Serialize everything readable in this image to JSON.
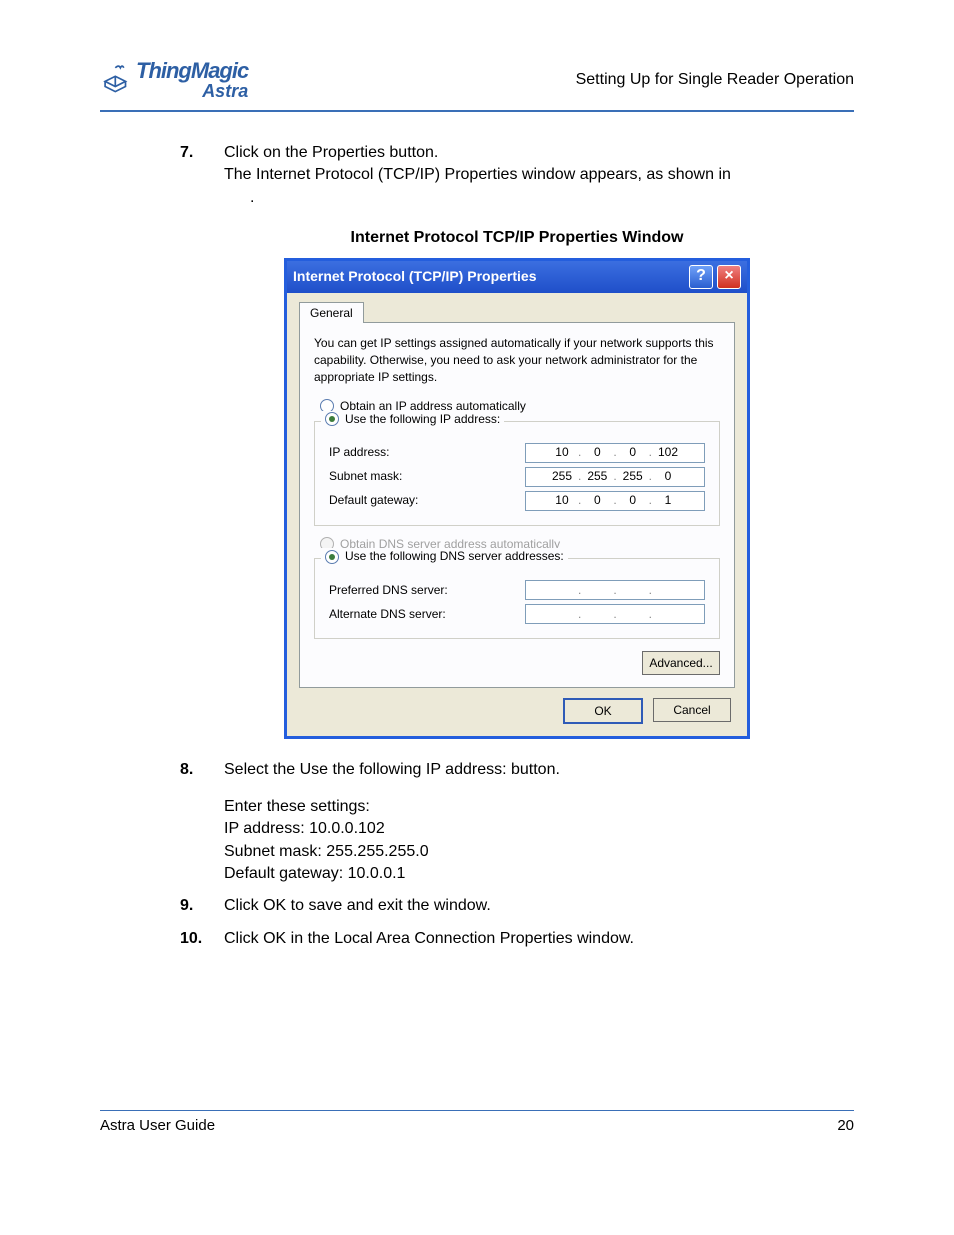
{
  "header": {
    "logo_main": "ThingMagic",
    "logo_sub": "Astra",
    "section": "Setting Up for Single Reader Operation"
  },
  "steps": {
    "s7_num": "7.",
    "s7_l1": "Click on the Properties button.",
    "s7_l2": "The Internet Protocol (TCP/IP) Properties window appears, as shown in",
    "s7_l3": ".",
    "figure_title": "Internet Protocol TCP/IP Properties Window",
    "s8_num": "8.",
    "s8_l1": "Select the Use the following IP address: button.",
    "s8_l2": "Enter these settings:",
    "s8_l3": "IP address: 10.0.0.102",
    "s8_l4": "Subnet mask: 255.255.255.0",
    "s8_l5": "Default gateway: 10.0.0.1",
    "s9_num": "9.",
    "s9_l1": "Click OK to save and exit the window.",
    "s10_num": "10.",
    "s10_l1": "Click OK in the Local Area Connection Properties window."
  },
  "dialog": {
    "title": "Internet Protocol (TCP/IP) Properties",
    "help": "?",
    "close": "×",
    "tab": "General",
    "desc": "You can get IP settings assigned automatically if your network supports this capability. Otherwise, you need to ask your network administrator for the appropriate IP settings.",
    "r_obtain_ip": "Obtain an IP address automatically",
    "r_use_ip": "Use the following IP address:",
    "lbl_ip": "IP address:",
    "lbl_subnet": "Subnet mask:",
    "lbl_gw": "Default gateway:",
    "ip": {
      "a": "10",
      "b": "0",
      "c": "0",
      "d": "102"
    },
    "subnet": {
      "a": "255",
      "b": "255",
      "c": "255",
      "d": "0"
    },
    "gw": {
      "a": "10",
      "b": "0",
      "c": "0",
      "d": "1"
    },
    "r_obtain_dns": "Obtain DNS server address automatically",
    "r_use_dns": "Use the following DNS server addresses:",
    "lbl_pref_dns": "Preferred DNS server:",
    "lbl_alt_dns": "Alternate DNS server:",
    "btn_adv": "Advanced...",
    "btn_ok": "OK",
    "btn_cancel": "Cancel"
  },
  "footer": {
    "left": "Astra User Guide",
    "right": "20"
  }
}
